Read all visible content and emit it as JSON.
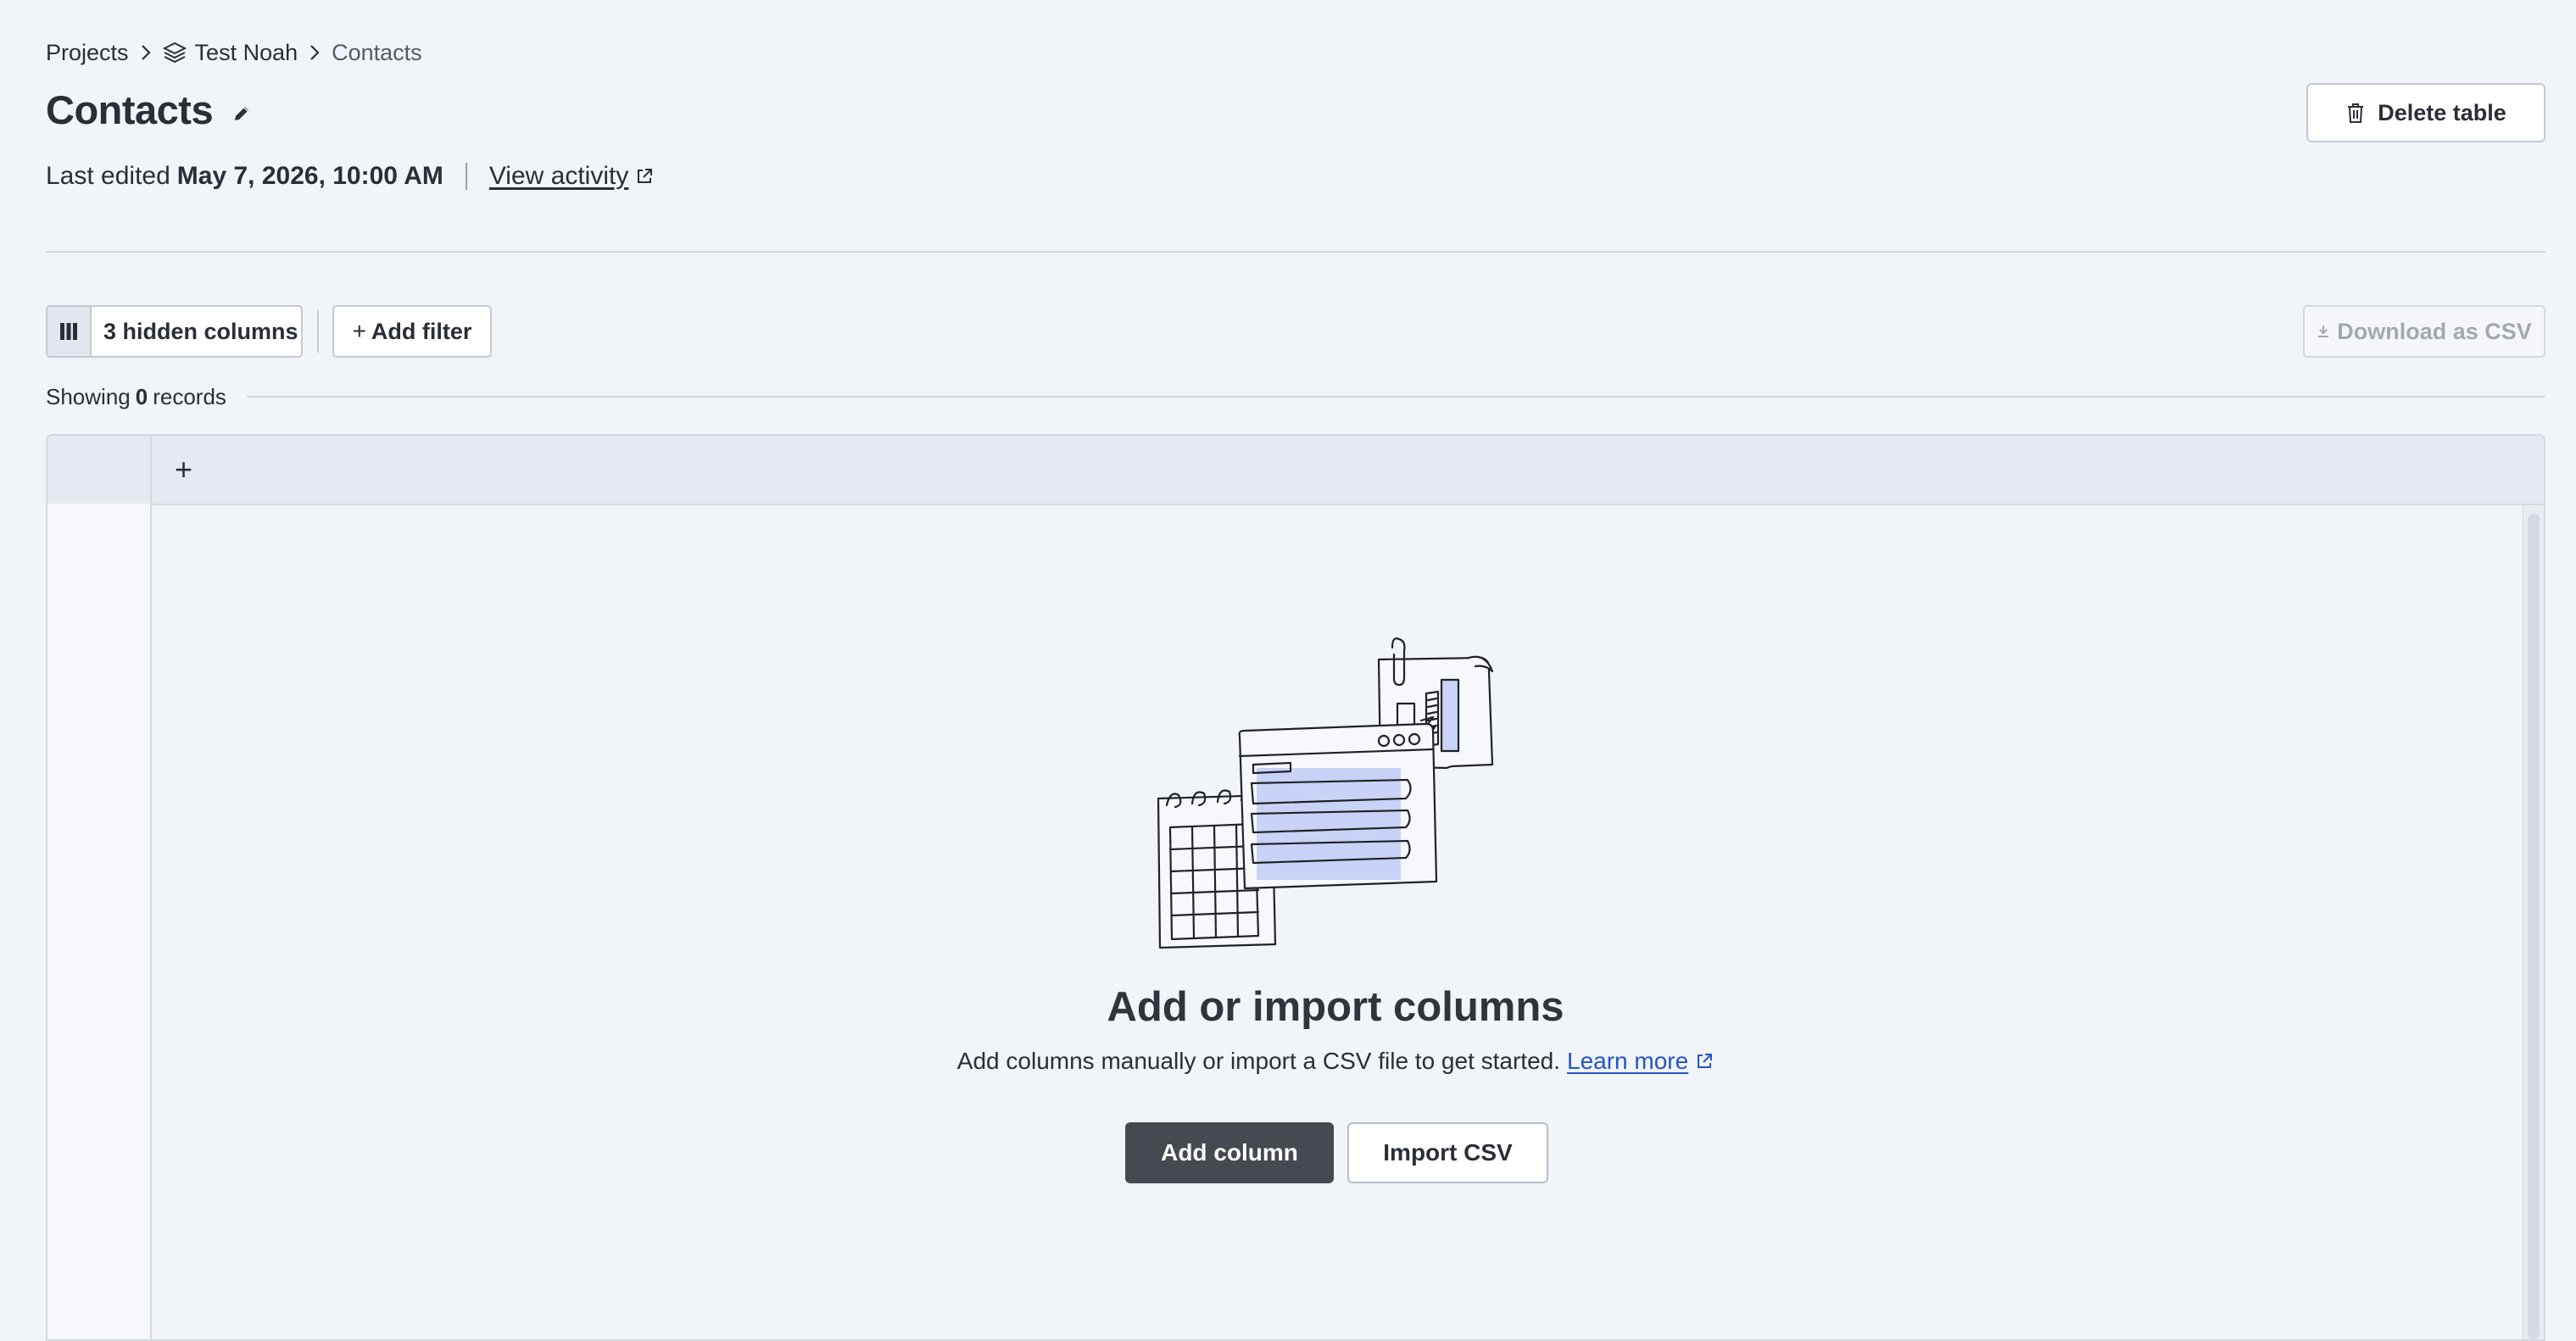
{
  "breadcrumb": {
    "projects": "Projects",
    "project": "Test Noah",
    "current": "Contacts"
  },
  "header": {
    "title": "Contacts",
    "last_edited_label": "Last edited",
    "last_edited_value": "May 7, 2026, 10:00 AM",
    "view_activity": "View activity",
    "delete_table": "Delete table"
  },
  "toolbar": {
    "hidden_columns": "3 hidden columns",
    "add_filter": "Add filter",
    "add_filter_prefix": "+",
    "download_csv": "Download as CSV"
  },
  "records": {
    "prefix": "Showing",
    "count": "0",
    "suffix": "records"
  },
  "table": {
    "add_column_glyph": "+"
  },
  "empty_state": {
    "title": "Add or import columns",
    "description": "Add columns manually or import a CSV file to get started.",
    "learn_more": "Learn more",
    "add_column": "Add column",
    "import_csv": "Import CSV"
  },
  "icons": {
    "breadcrumb_chevron": "chevron-right-icon",
    "project": "stack-icon",
    "edit_title": "pencil-icon",
    "external_link": "external-link-icon",
    "delete": "trash-icon",
    "columns": "columns-icon",
    "download": "download-icon"
  },
  "colors": {
    "background": "#f1f4f9",
    "primary_button": "#454950",
    "link": "#2354c7",
    "illustration_fill": "#c9d2f7"
  }
}
